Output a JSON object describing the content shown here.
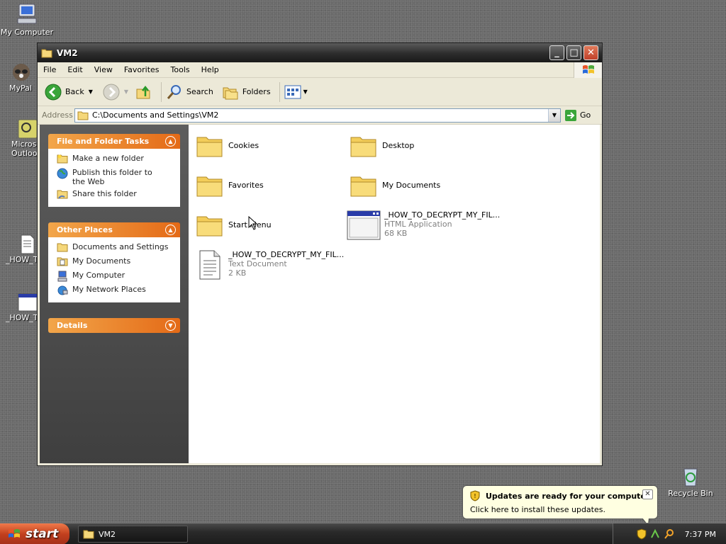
{
  "desktop": {
    "icons": [
      {
        "label": "My Computer"
      },
      {
        "label": "MyPal"
      },
      {
        "label": "Microsoft Outlook"
      },
      {
        "label": "_HOW_TO"
      },
      {
        "label": "_HOW_TO"
      },
      {
        "label": "Recycle Bin"
      }
    ]
  },
  "window": {
    "title": "VM2",
    "controls": {
      "minimize": "_",
      "maximize": "□",
      "close": "✕"
    },
    "menu": [
      "File",
      "Edit",
      "View",
      "Favorites",
      "Tools",
      "Help"
    ],
    "toolbar": {
      "back": "Back",
      "search": "Search",
      "folders": "Folders"
    },
    "address": {
      "label": "Address",
      "value": "C:\\Documents and Settings\\VM2",
      "go": "Go"
    },
    "taskpane": {
      "file_tasks": {
        "title": "File and Folder Tasks",
        "items": [
          "Make a new folder",
          "Publish this folder to the Web",
          "Share this folder"
        ]
      },
      "other_places": {
        "title": "Other Places",
        "items": [
          "Documents and Settings",
          "My Documents",
          "My Computer",
          "My Network Places"
        ]
      },
      "details": {
        "title": "Details"
      }
    },
    "files": [
      {
        "name": "Cookies",
        "type": "folder"
      },
      {
        "name": "Desktop",
        "type": "folder"
      },
      {
        "name": "Favorites",
        "type": "folder"
      },
      {
        "name": "My Documents",
        "type": "folder"
      },
      {
        "name": "Start Menu",
        "type": "folder"
      },
      {
        "name": "_HOW_TO_DECRYPT_MY_FIL...",
        "type": "hta",
        "kind": "HTML Application",
        "size": "68 KB"
      },
      {
        "name": "_HOW_TO_DECRYPT_MY_FIL...",
        "type": "txt",
        "kind": "Text Document",
        "size": "2 KB"
      }
    ]
  },
  "balloon": {
    "title": "Updates are ready for your computer",
    "message": "Click here to install these updates.",
    "close": "✕"
  },
  "taskbar": {
    "start": "start",
    "items": [
      {
        "label": "VM2"
      }
    ],
    "clock": "7:37 PM"
  },
  "colors": {
    "taskpane_header": "#e46a17",
    "desktop": "#6a6a6a",
    "balloon": "#ffffe1"
  }
}
